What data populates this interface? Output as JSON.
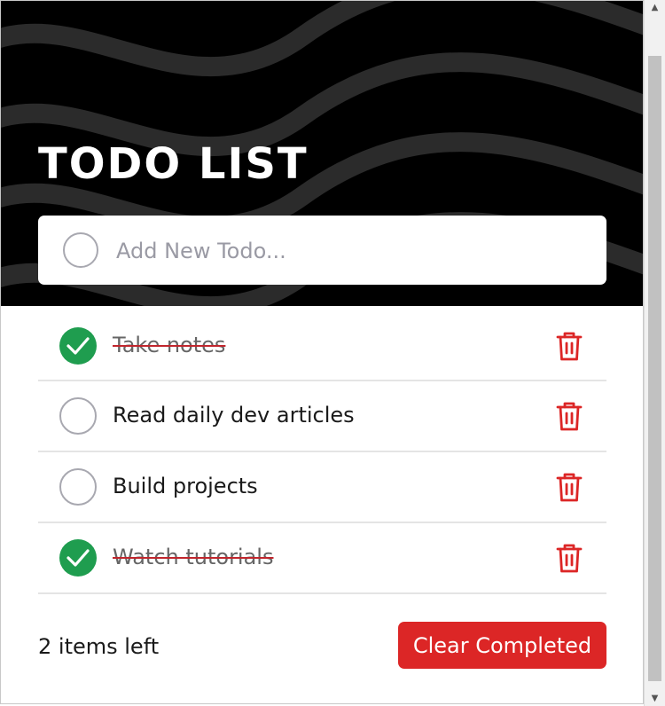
{
  "header": {
    "title": "TODO LIST"
  },
  "new_todo": {
    "placeholder": "Add New Todo...",
    "value": ""
  },
  "todos": [
    {
      "text": "Take notes",
      "completed": true
    },
    {
      "text": "Read daily dev articles",
      "completed": false
    },
    {
      "text": "Build projects",
      "completed": false
    },
    {
      "text": "Watch tutorials",
      "completed": true
    }
  ],
  "footer": {
    "items_left": "2 items left",
    "clear_label": "Clear Completed"
  },
  "colors": {
    "accent_red": "#dc2626",
    "done_green": "#1f9d4f",
    "hero_bg": "#000000"
  },
  "icons": {
    "check": "check-icon",
    "delete": "trash-icon",
    "scroll_up": "triangle-up-icon",
    "scroll_down": "triangle-down-icon"
  }
}
